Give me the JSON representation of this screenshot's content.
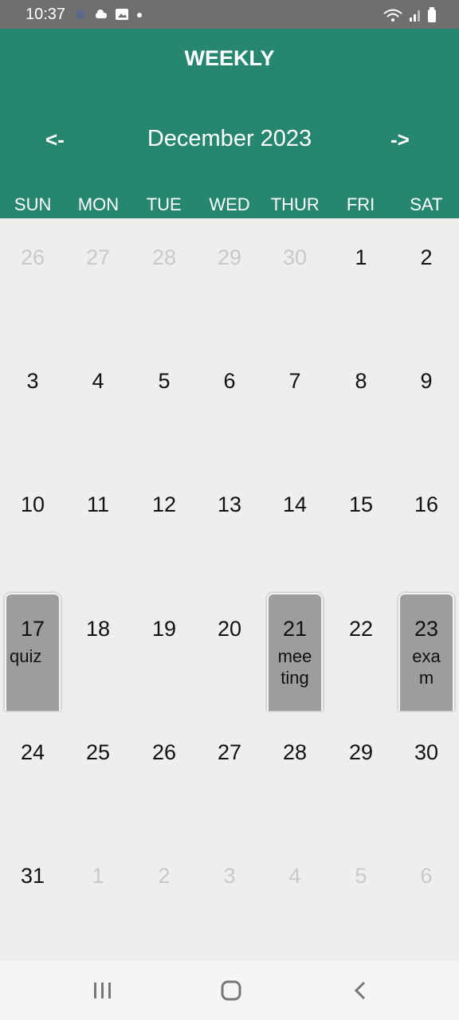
{
  "status_bar": {
    "time": "10:37",
    "left_icons": [
      "app-icon",
      "cloud-icon",
      "image-icon",
      "dot-icon"
    ],
    "right_icons": [
      "wifi-icon",
      "signal-icon",
      "battery-icon"
    ]
  },
  "header": {
    "title": "WEEKLY",
    "prev_label": "<-",
    "next_label": "->",
    "month_label": "December 2023"
  },
  "weekdays": [
    "SUN",
    "MON",
    "TUE",
    "WED",
    "THUR",
    "FRI",
    "SAT"
  ],
  "weeks": [
    [
      {
        "day": "26",
        "muted": true
      },
      {
        "day": "27",
        "muted": true
      },
      {
        "day": "28",
        "muted": true
      },
      {
        "day": "29",
        "muted": true
      },
      {
        "day": "30",
        "muted": true
      },
      {
        "day": "1"
      },
      {
        "day": "2"
      }
    ],
    [
      {
        "day": "3"
      },
      {
        "day": "4"
      },
      {
        "day": "5"
      },
      {
        "day": "6"
      },
      {
        "day": "7"
      },
      {
        "day": "8"
      },
      {
        "day": "9"
      }
    ],
    [
      {
        "day": "10"
      },
      {
        "day": "11"
      },
      {
        "day": "12"
      },
      {
        "day": "13"
      },
      {
        "day": "14"
      },
      {
        "day": "15"
      },
      {
        "day": "16"
      }
    ],
    [
      {
        "day": "17",
        "event": "quiz"
      },
      {
        "day": "18"
      },
      {
        "day": "19"
      },
      {
        "day": "20"
      },
      {
        "day": "21",
        "event": "mee\nting"
      },
      {
        "day": "22"
      },
      {
        "day": "23",
        "event": "exa\nm"
      }
    ],
    [
      {
        "day": "24"
      },
      {
        "day": "25"
      },
      {
        "day": "26"
      },
      {
        "day": "27"
      },
      {
        "day": "28"
      },
      {
        "day": "29"
      },
      {
        "day": "30"
      }
    ],
    [
      {
        "day": "31"
      },
      {
        "day": "1",
        "muted": true
      },
      {
        "day": "2",
        "muted": true
      },
      {
        "day": "3",
        "muted": true
      },
      {
        "day": "4",
        "muted": true
      },
      {
        "day": "5",
        "muted": true
      },
      {
        "day": "6",
        "muted": true
      }
    ]
  ],
  "nav_bar": {
    "buttons": [
      "recents-icon",
      "home-icon",
      "back-icon"
    ]
  },
  "colors": {
    "header": "#268670",
    "event_card": "#9d9d9d",
    "muted_text": "#c9c9c9"
  }
}
